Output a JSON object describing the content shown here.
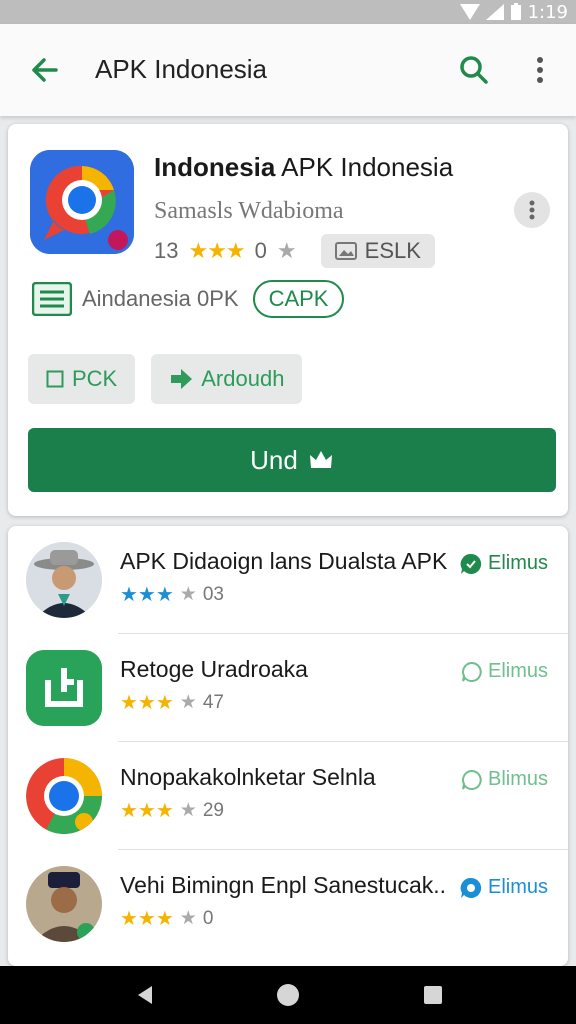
{
  "status_bar": {
    "time": "1:19"
  },
  "app_bar": {
    "title": "APK Indonesia"
  },
  "app": {
    "name_bold": "Indonesia",
    "name_rest": " APK Indonesia",
    "developer": "Samasls Wdabioma",
    "rating_count": "13",
    "rating_tail": "0",
    "tag": "ESLK",
    "category_text": "Aindanesia 0PK",
    "category_chip": "CAPK",
    "btn_pck": "PCK",
    "btn_android": "Ardoudh",
    "install": "Und"
  },
  "list": [
    {
      "title": "APK Didaoign lans Dualsta APK",
      "rating": "03",
      "action": "Elimus",
      "stars": 3,
      "action_color": "#1f8a4c"
    },
    {
      "title": "Retoge Uradroaka",
      "rating": "47",
      "action": "Elimus",
      "stars": 3,
      "action_color": "#6fbf8f"
    },
    {
      "title": "Nnopakakolnketar Selnla",
      "rating": "29",
      "action": "Blimus",
      "stars": 3,
      "action_color": "#6fbf8f"
    },
    {
      "title": "Vehi Bimingn Enpl Sanestucak..",
      "rating": "0",
      "action": "Elimus",
      "stars": 3,
      "action_color": "#1a8fd6"
    }
  ],
  "colors": {
    "primary": "#1a7f4b",
    "accent_green": "#1f8a4c",
    "star": "#f4b400"
  }
}
